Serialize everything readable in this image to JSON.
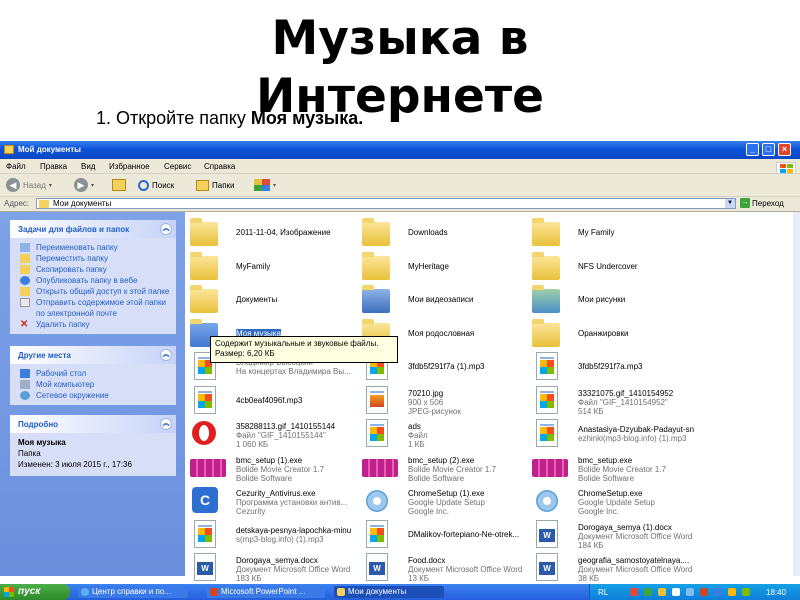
{
  "slide": {
    "title": "Музыка в Интернете",
    "step_number": "1. Откройте папку ",
    "step_target": "Моя музыка."
  },
  "window": {
    "title": "Мой документы",
    "menu": [
      "Файл",
      "Правка",
      "Вид",
      "Избранное",
      "Сервис",
      "Справка"
    ],
    "toolbar": {
      "back": "Назад",
      "search": "Поиск",
      "folders": "Папки"
    },
    "address": {
      "label": "Адрес:",
      "value": "Мои документы",
      "go": "Переход"
    }
  },
  "taskpane": {
    "file_tasks": {
      "title": "Задачи для файлов и папок",
      "links": [
        "Переименовать папку",
        "Переместить папку",
        "Скопировать папку",
        "Опубликовать папку в вебе",
        "Открыть общий доступ к этой папке",
        "Отправить содержимое этой папки по электронной почте",
        "Удалить папку"
      ]
    },
    "other_places": {
      "title": "Другие места",
      "links": [
        "Рабочий стол",
        "Мой компьютер",
        "Сетевое окружение"
      ]
    },
    "details": {
      "title": "Подробно",
      "name": "Моя музыка",
      "kind": "Папка",
      "modified": "Изменен: 3 июля 2015 г., 17:36"
    }
  },
  "files": [
    {
      "name": "2011-11-04, Изображение",
      "lines": [],
      "icon": "folder-icon"
    },
    {
      "name": "Downloads",
      "lines": [],
      "icon": "folder-icon"
    },
    {
      "name": "My Family",
      "lines": [],
      "icon": "folder-icon"
    },
    {
      "name": "MyFamily",
      "lines": [],
      "icon": "folder-icon"
    },
    {
      "name": "MyHeritage",
      "lines": [],
      "icon": "folder-icon"
    },
    {
      "name": "NFS Undercover",
      "lines": [],
      "icon": "folder-icon"
    },
    {
      "name": "Документы",
      "lines": [],
      "icon": "folder-icon"
    },
    {
      "name": "Мои видеозаписи",
      "lines": [],
      "icon": "video-folder-icon"
    },
    {
      "name": "Мои рисунки",
      "lines": [],
      "icon": "pictures-folder-icon"
    },
    {
      "name": "Моя музыка",
      "lines": [],
      "icon": "music-folder-icon",
      "selected": true
    },
    {
      "name": "Моя родословная",
      "lines": [],
      "icon": "folder-icon"
    },
    {
      "name": "Оранжировки",
      "lines": [],
      "icon": "folder-icon"
    },
    {
      "name": "",
      "lines": [
        "Владимир Высоцкий",
        "На концертах Владимира Вы..."
      ],
      "icon": "media-file-icon"
    },
    {
      "name": "3fdb5f291f7a (1).mp3",
      "lines": [],
      "icon": "media-file-icon"
    },
    {
      "name": "3fdb5f291f7a.mp3",
      "lines": [],
      "icon": "media-file-icon"
    },
    {
      "name": "4cb0eaf4096f.mp3",
      "lines": [],
      "icon": "media-file-icon"
    },
    {
      "name": "70210.jpg",
      "lines": [
        "900 x 506",
        "JPEG-рисунок"
      ],
      "icon": "image-file-icon"
    },
    {
      "name": "33321075.gif_1410154952",
      "lines": [
        "Файл \"GIF_1410154952\"",
        "514 КБ"
      ],
      "icon": "media-file-icon"
    },
    {
      "name": "358288113.gif_1410155144",
      "lines": [
        "Файл \"GIF_1410155144\"",
        "1 060 КБ"
      ],
      "icon": "opera-file-icon"
    },
    {
      "name": "ads",
      "lines": [
        "Файл",
        "1 КБ"
      ],
      "icon": "media-file-icon"
    },
    {
      "name": "Anastasiya-Dzyubak-Padayut-sn",
      "lines": [
        "ezhinki(mp3-blog.info) (1).mp3"
      ],
      "icon": "media-file-icon"
    },
    {
      "name": "bmc_setup (1).exe",
      "lines": [
        "Bolide Movie Creator 1.7",
        "Bolide Software"
      ],
      "icon": "film-file-icon"
    },
    {
      "name": "bmc_setup (2).exe",
      "lines": [
        "Bolide Movie Creator 1.7",
        "Bolide Software"
      ],
      "icon": "film-file-icon"
    },
    {
      "name": "bmc_setup.exe",
      "lines": [
        "Bolide Movie Creator 1.7",
        "Bolide Software"
      ],
      "icon": "film-file-icon"
    },
    {
      "name": "Cezurity_Antivirus.exe",
      "lines": [
        "Программа установки антив...",
        "Cezurity"
      ],
      "icon": "cezurity-file-icon"
    },
    {
      "name": "ChromeSetup (1).exe",
      "lines": [
        "Google Update Setup",
        "Google Inc."
      ],
      "icon": "setup-file-icon"
    },
    {
      "name": "ChromeSetup.exe",
      "lines": [
        "Google Update Setup",
        "Google Inc."
      ],
      "icon": "setup-file-icon"
    },
    {
      "name": "detskaya-pesnya-lapochka-minu",
      "lines": [
        "s(mp3-blog.info) (1).mp3"
      ],
      "icon": "media-file-icon"
    },
    {
      "name": "DMalikov-fortepiano-Ne-otrek...",
      "lines": [],
      "icon": "media-file-icon"
    },
    {
      "name": "Dorogaya_semya (1).docx",
      "lines": [
        "Документ Microsoft Office Word",
        "184 КБ"
      ],
      "icon": "word-file-icon"
    },
    {
      "name": "Dorogaya_semya.docx",
      "lines": [
        "Документ Microsoft Office Word",
        "183 КБ"
      ],
      "icon": "word-file-icon"
    },
    {
      "name": "Food.docx",
      "lines": [
        "Документ Microsoft Office Word",
        "13 КБ"
      ],
      "icon": "word-file-icon"
    },
    {
      "name": "geografia_samostoyatelnaya....",
      "lines": [
        "Документ Microsoft Office Word",
        "38 КБ"
      ],
      "icon": "word-file-icon"
    }
  ],
  "tooltip": {
    "line1": "Содержит музыкальные и звуковые файлы.",
    "line2": "Размер: 6,20 КБ"
  },
  "taskbar": {
    "start": "пуск",
    "items": [
      "Центр справки и по...",
      "Microsoft PowerPoint ...",
      "Мои документы"
    ],
    "lang": "RL",
    "clock": "18:40"
  }
}
